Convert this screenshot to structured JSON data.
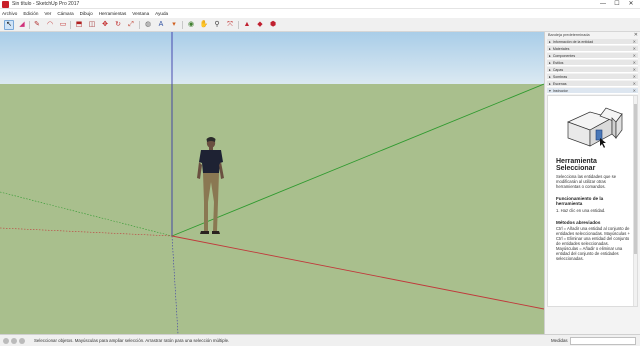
{
  "window": {
    "title": "Sin título - SketchUp Pro 2017",
    "controls": [
      "—",
      "☐",
      "✕"
    ]
  },
  "menu": [
    "Archivo",
    "Edición",
    "Ver",
    "Cámara",
    "Dibujo",
    "Herramientas",
    "Ventana",
    "Ayuda"
  ],
  "toolbar": {
    "tools": [
      {
        "name": "select-tool",
        "glyph": "↖",
        "color": "#1a1a1a",
        "active": true
      },
      {
        "name": "eraser-tool",
        "glyph": "◢",
        "color": "#d0307a"
      },
      {
        "name": "line-tool",
        "glyph": "✎",
        "color": "#b03030"
      },
      {
        "name": "arc-tool",
        "glyph": "◠",
        "color": "#c04040"
      },
      {
        "name": "shape-tool",
        "glyph": "▭",
        "color": "#c03030"
      },
      {
        "name": "push-pull-tool",
        "glyph": "⬒",
        "color": "#b02020"
      },
      {
        "name": "offset-tool",
        "glyph": "◫",
        "color": "#a03030"
      },
      {
        "name": "move-tool",
        "glyph": "✥",
        "color": "#c02020"
      },
      {
        "name": "rotate-tool",
        "glyph": "↻",
        "color": "#c03030"
      },
      {
        "name": "scale-tool",
        "glyph": "⤢",
        "color": "#c04030"
      },
      {
        "name": "tape-measure-tool",
        "glyph": "◍",
        "color": "#606060"
      },
      {
        "name": "text-tool",
        "glyph": "A",
        "color": "#3050a0"
      },
      {
        "name": "paint-bucket-tool",
        "glyph": "▾",
        "color": "#d06020"
      },
      {
        "name": "orbit-tool",
        "glyph": "◉",
        "color": "#408030"
      },
      {
        "name": "pan-tool",
        "glyph": "✋",
        "color": "#806040"
      },
      {
        "name": "zoom-tool",
        "glyph": "⚲",
        "color": "#404040"
      },
      {
        "name": "zoom-extents-tool",
        "glyph": "⤧",
        "color": "#c03030"
      },
      {
        "name": "warehouse-tool",
        "glyph": "▲",
        "color": "#c02030"
      },
      {
        "name": "extension-tool",
        "glyph": "◆",
        "color": "#c02030"
      },
      {
        "name": "layout-tool",
        "glyph": "⬢",
        "color": "#c02030"
      }
    ]
  },
  "tray": {
    "title": "Bandeja predeterminada",
    "panels": [
      "Información de la entidad",
      "Materiales",
      "Componentes",
      "Estilos",
      "Capas",
      "Sombras",
      "Escenas",
      "Instructor"
    ],
    "instructor": {
      "heading": "Herramienta Seleccionar",
      "description": "Selecciona las entidades que se modificarán al utilizar otras herramientas o comandos.",
      "operation_title": "Funcionamiento de la herramienta",
      "operation_step": "1. Haz clic en una entidad.",
      "modifiers_title": "Métodos abreviados",
      "modifiers_text": "Ctrl = Añadir una entidad al conjunto de entidades seleccionadas. Mayúsculas + Ctrl = Eliminar una entidad del conjunto de entidades seleccionadas. Mayúsculas = Añadir o eliminar una entidad del conjunto de entidades seleccionadas."
    }
  },
  "status": {
    "message": "Seleccionar objetos. Mayúsculas para ampliar selección. Arrastrar ratón para una selección múltiple.",
    "measure_label": "Medidas"
  },
  "colors": {
    "sky_top": "#a9cde8",
    "ground": "#a9bf8d",
    "axis_red": "#c0393b",
    "axis_green": "#3aa03a",
    "axis_blue": "#3a3aa8"
  }
}
